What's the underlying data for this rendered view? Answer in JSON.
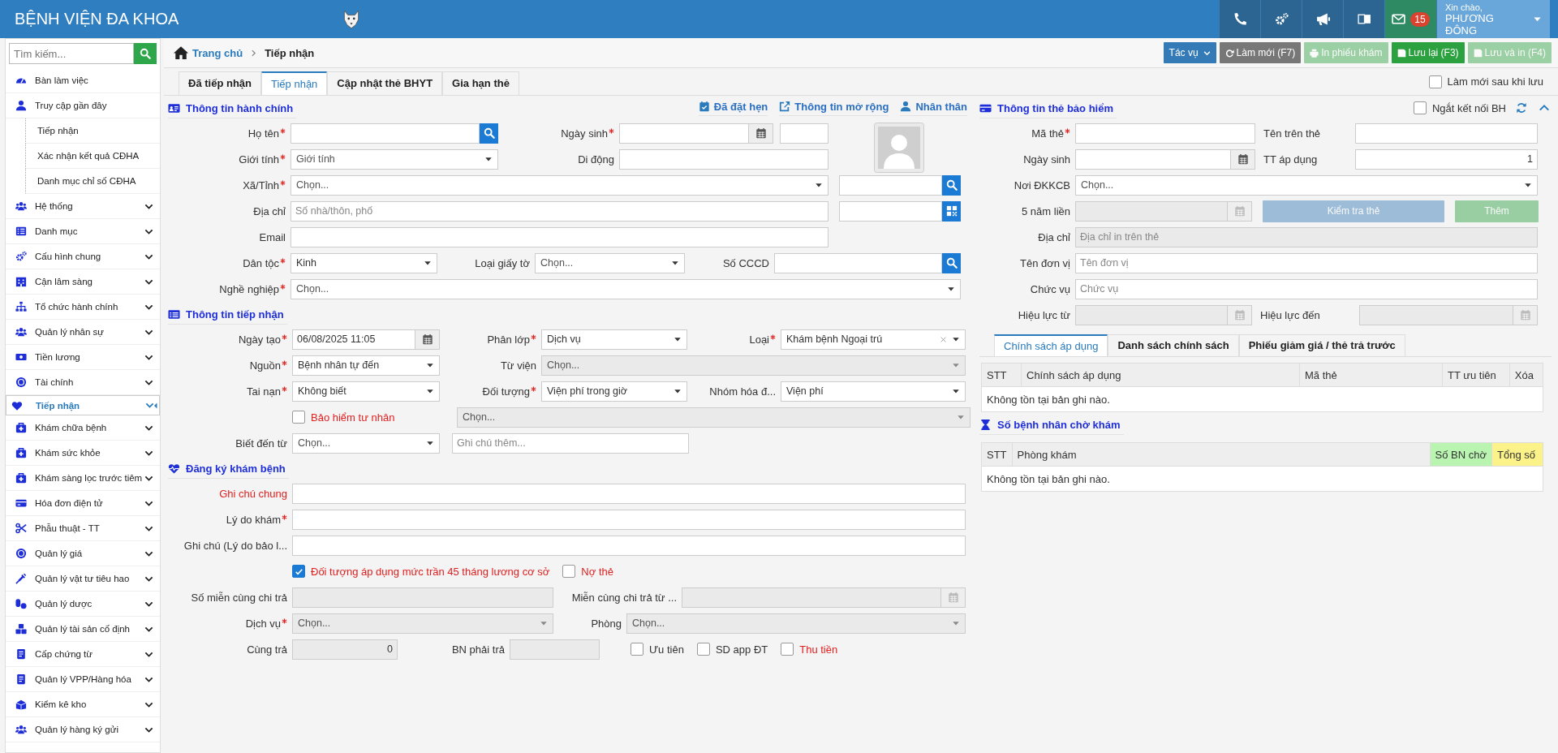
{
  "header": {
    "title": "BỆNH VIỆN ĐA KHOA",
    "notifications": "15",
    "greeting": "Xin chào,",
    "user_name": "PHƯƠNG ĐÔNG"
  },
  "sidebar": {
    "search": {
      "placeholder": "Tìm kiếm..."
    },
    "items": [
      {
        "label": "Bàn làm việc",
        "kind": "link",
        "selected": false
      },
      {
        "label": "Truy cập gần đây",
        "kind": "link",
        "selected": false,
        "children": [
          {
            "label": "Tiếp nhận",
            "selected": false
          },
          {
            "label": "Xác nhận kết quả CĐHA",
            "selected": false
          },
          {
            "label": "Danh mục chỉ số CĐHA",
            "selected": false
          }
        ]
      },
      {
        "label": "Hệ thống",
        "kind": "group",
        "selected": false
      },
      {
        "label": "Danh mục",
        "kind": "group",
        "selected": false
      },
      {
        "label": "Cấu hình chung",
        "kind": "group",
        "selected": false
      },
      {
        "label": "Cận lâm sàng",
        "kind": "group",
        "selected": false
      },
      {
        "label": "Tổ chức hành chính",
        "kind": "group",
        "selected": false
      },
      {
        "label": "Quản lý nhân sự",
        "kind": "group",
        "selected": false
      },
      {
        "label": "Tiền lương",
        "kind": "group",
        "selected": false
      },
      {
        "label": "Tài chính",
        "kind": "group",
        "selected": false
      },
      {
        "label": "Tiếp nhận",
        "kind": "group",
        "selected": true
      },
      {
        "label": "Khám chữa bệnh",
        "kind": "group",
        "selected": false
      },
      {
        "label": "Khám sức khỏe",
        "kind": "group",
        "selected": false
      },
      {
        "label": "Khám sàng lọc trước tiêm",
        "kind": "group",
        "selected": false
      },
      {
        "label": "Hóa đơn điện tử",
        "kind": "group",
        "selected": false
      },
      {
        "label": "Phẫu thuật - TT",
        "kind": "group",
        "selected": false
      },
      {
        "label": "Quản lý giá",
        "kind": "group",
        "selected": false
      },
      {
        "label": "Quản lý vật tư tiêu hao",
        "kind": "group",
        "selected": false
      },
      {
        "label": "Quản lý dược",
        "kind": "group",
        "selected": false
      },
      {
        "label": "Quản lý tài sản cố định",
        "kind": "group",
        "selected": false
      },
      {
        "label": "Cấp chứng từ",
        "kind": "group",
        "selected": false
      },
      {
        "label": "Quản lý VPP/Hàng hóa",
        "kind": "group",
        "selected": false
      },
      {
        "label": "Kiểm kê kho",
        "kind": "group",
        "selected": false
      },
      {
        "label": "Quản lý hàng ký gửi",
        "kind": "group",
        "selected": false
      }
    ]
  },
  "breadcrumb": [
    {
      "label": "Trang chủ"
    },
    {
      "label": "Tiếp nhận"
    }
  ],
  "actions": [
    {
      "label": "Tác vụ",
      "kind": "menu",
      "disabled": false
    },
    {
      "label": "Làm mới (F7)",
      "kind": "refresh",
      "disabled": false
    },
    {
      "label": "In phiếu khám",
      "kind": "print",
      "disabled": true
    },
    {
      "label": "Lưu lại (F3)",
      "kind": "save",
      "disabled": false
    },
    {
      "label": "Lưu và in (F4)",
      "kind": "save",
      "disabled": true
    }
  ],
  "tabs": [
    {
      "label": "Đã tiếp nhận",
      "selected": false
    },
    {
      "label": "Tiếp nhận",
      "selected": true
    },
    {
      "label": "Cập nhật thẻ BHYT",
      "selected": false
    },
    {
      "label": "Gia hạn thẻ",
      "selected": false
    }
  ],
  "refresh_after_save": {
    "label": "Làm mới sau khi lưu",
    "checked": false
  },
  "admin": {
    "title": "Thông tin hành chính",
    "links": [
      {
        "label": "Đã đặt hẹn"
      },
      {
        "label": "Thông tin mở rộng"
      },
      {
        "label": "Nhân thân"
      }
    ],
    "fields": [
      {
        "label": "Họ tên",
        "required": true,
        "kind": "search"
      },
      {
        "label": "Ngày sinh",
        "required": true,
        "kind": "date"
      },
      {
        "kind": "text"
      },
      {
        "label": "Giới tính",
        "required": true,
        "kind": "select",
        "placeholder": "Giới tính"
      },
      {
        "label": "Di động",
        "required": false,
        "kind": "text"
      },
      {
        "label": "Xã/Tỉnh",
        "required": true,
        "kind": "select",
        "placeholder": "Chọn..."
      },
      {
        "kind": "search"
      },
      {
        "label": "Địa chỉ",
        "required": false,
        "kind": "text",
        "placeholder": "Số nhà/thôn, phố"
      },
      {
        "kind": "qr"
      },
      {
        "label": "Email",
        "required": false,
        "kind": "text"
      },
      {
        "label": "Dân tộc",
        "required": true,
        "kind": "select",
        "value": "Kinh"
      },
      {
        "label": "Loại giấy tờ",
        "required": false,
        "kind": "select",
        "placeholder": "Chọn..."
      },
      {
        "label": "Số CCCD",
        "required": false,
        "kind": "search"
      },
      {
        "label": "Nghề nghiệp",
        "required": true,
        "kind": "select",
        "placeholder": "Chọn..."
      }
    ]
  },
  "reception": {
    "title": "Thông tin tiếp nhận",
    "fields": [
      {
        "label": "Ngày tạo",
        "required": true,
        "kind": "date",
        "value": "06/08/2025 11:05",
        "disabled": false
      },
      {
        "label": "Phân lớp",
        "required": true,
        "kind": "select",
        "value": "Dịch vụ",
        "disabled": false
      },
      {
        "label": "Loại",
        "required": true,
        "kind": "select",
        "value": "Khám bệnh Ngoại trú",
        "clearable": true,
        "disabled": false
      },
      {
        "label": "Nguồn",
        "required": true,
        "kind": "select",
        "value": "Bệnh nhân tự đến",
        "disabled": false
      },
      {
        "label": "Từ viện",
        "required": false,
        "kind": "select",
        "placeholder": "Chọn...",
        "disabled": true
      },
      {
        "label": "Tai nạn",
        "required": true,
        "kind": "select",
        "value": "Không biết",
        "disabled": false
      },
      {
        "label": "Đối tượng",
        "required": true,
        "kind": "select",
        "value": "Viện phí trong giờ",
        "disabled": false
      },
      {
        "label": "Nhóm hóa đ...",
        "required": false,
        "kind": "select",
        "value": "Viện phí",
        "disabled": false
      },
      {
        "label": "Bảo hiểm tư nhân",
        "kind": "checkbox",
        "checked": false,
        "emphasis": true
      },
      {
        "kind": "select",
        "placeholder": "Chọn...",
        "disabled": true
      },
      {
        "label": "Biết đến từ",
        "required": false,
        "kind": "select",
        "placeholder": "Chọn...",
        "disabled": false
      },
      {
        "kind": "text",
        "placeholder": "Ghi chú thêm...",
        "disabled": false
      }
    ]
  },
  "registration": {
    "title": "Đăng ký khám bệnh",
    "fields": [
      {
        "label": "Ghi chú chung",
        "required": false,
        "emphasis": true,
        "kind": "text",
        "disabled": false
      },
      {
        "label": "Lý do khám",
        "required": true,
        "emphasis": false,
        "kind": "text",
        "disabled": false
      },
      {
        "label": "Ghi chú (Lý do bảo l...",
        "required": false,
        "emphasis": false,
        "kind": "text",
        "disabled": false
      },
      {
        "label": "Đối tượng áp dụng mức trần 45 tháng lương cơ sở",
        "kind": "checkbox",
        "checked": true,
        "emphasis": true
      },
      {
        "label": "Nợ thẻ",
        "kind": "checkbox",
        "checked": false,
        "emphasis": true
      },
      {
        "label": "Số miễn cùng chi trả",
        "required": false,
        "emphasis": false,
        "kind": "text",
        "disabled": true
      },
      {
        "label": "Miễn cùng chi trả từ ...",
        "required": false,
        "emphasis": false,
        "kind": "date",
        "disabled": true
      },
      {
        "label": "Dịch vụ",
        "required": true,
        "emphasis": false,
        "kind": "select",
        "placeholder": "Chọn...",
        "disabled": true
      },
      {
        "label": "Phòng",
        "required": false,
        "emphasis": false,
        "kind": "select",
        "placeholder": "Chọn...",
        "disabled": true
      },
      {
        "label": "Cùng trả",
        "required": false,
        "emphasis": false,
        "kind": "number",
        "value": "0",
        "disabled": true
      },
      {
        "label": "BN phải trả",
        "required": false,
        "emphasis": false,
        "kind": "text",
        "disabled": true
      },
      {
        "label": "Ưu tiên",
        "kind": "checkbox",
        "checked": false,
        "emphasis": false
      },
      {
        "label": "SD app ĐT",
        "kind": "checkbox",
        "checked": false,
        "emphasis": false
      },
      {
        "label": "Thu tiền",
        "kind": "checkbox",
        "checked": false,
        "emphasis": true
      }
    ]
  },
  "insurance": {
    "title": "Thông tin thẻ bảo hiểm",
    "disconnect": {
      "label": "Ngắt kết nối BH",
      "checked": false
    },
    "fields": [
      {
        "label": "Mã thẻ",
        "required": true,
        "kind": "text",
        "disabled": false
      },
      {
        "label": "Tên trên thẻ",
        "required": false,
        "kind": "text",
        "disabled": false
      },
      {
        "label": "Ngày sinh",
        "required": false,
        "kind": "date",
        "disabled": false
      },
      {
        "label": "TT áp dụng",
        "required": false,
        "kind": "number",
        "value": "1",
        "disabled": false
      },
      {
        "label": "Nơi ĐKKCB",
        "required": false,
        "kind": "select",
        "placeholder": "Chọn...",
        "disabled": false
      },
      {
        "label": "5 năm liền",
        "required": false,
        "kind": "date",
        "disabled": true
      },
      {
        "label": "Địa chỉ",
        "required": false,
        "kind": "text",
        "placeholder": "Địa chỉ in trên thẻ",
        "disabled": true
      },
      {
        "label": "Tên đơn vị",
        "required": false,
        "kind": "text",
        "placeholder": "Tên đơn vị",
        "disabled": false
      },
      {
        "label": "Chức vụ",
        "required": false,
        "kind": "text",
        "placeholder": "Chức vụ",
        "disabled": false
      },
      {
        "label": "Hiệu lực từ",
        "required": false,
        "kind": "date",
        "disabled": true
      },
      {
        "label": "Hiệu lực đến",
        "required": false,
        "kind": "date",
        "disabled": true
      }
    ],
    "buttons": [
      {
        "label": "Kiểm tra thẻ",
        "kind": "check",
        "disabled": true
      },
      {
        "label": "Thêm",
        "kind": "add",
        "disabled": true
      }
    ],
    "tabs": [
      {
        "label": "Chính sách áp dụng",
        "selected": true
      },
      {
        "label": "Danh sách chính sách",
        "selected": false
      },
      {
        "label": "Phiếu giảm giá / thẻ trả trước",
        "selected": false
      }
    ],
    "table": {
      "columns": [
        {
          "label": "STT"
        },
        {
          "label": "Chính sách áp dụng"
        },
        {
          "label": "Mã thẻ"
        },
        {
          "label": "TT ưu tiên"
        },
        {
          "label": "Xóa"
        }
      ],
      "empty_message": "Không tồn tại bản ghi nào."
    }
  },
  "waiting": {
    "title": "Số bệnh nhân chờ khám",
    "table": {
      "columns": [
        {
          "label": "STT"
        },
        {
          "label": "Phòng khám"
        },
        {
          "label": "Số BN chờ",
          "color": "#b9f5b0"
        },
        {
          "label": "Tổng số",
          "color": "#fbf38a"
        }
      ],
      "empty_message": "Không tồn tại bản ghi nào."
    }
  }
}
